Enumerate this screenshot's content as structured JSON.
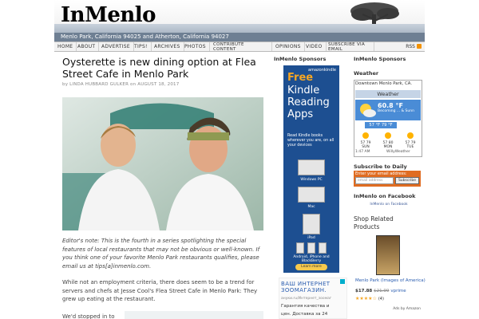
{
  "header": {
    "logo": "InMenlo",
    "tagline": "Menlo Park, California 94025 and Atherton, California 94027"
  },
  "nav": {
    "items": [
      "HOME",
      "ABOUT",
      "ADVERTISE",
      "TIPS!",
      "ARCHIVES",
      "PHOTOS"
    ],
    "contribute_1": "CONTRIBUTE",
    "contribute_2": "CONTENT",
    "items2": [
      "OPINIONS",
      "VIDEO"
    ],
    "subscribe": "SUBSCRIBE VIA EMAIL",
    "rss": "RSS"
  },
  "article": {
    "title": "Oysterette is new dining option at Flea Street Cafe in Menlo Park",
    "by": "by",
    "author": "LINDA HUBBARD GULKER",
    "on": "on",
    "date": "AUGUST 18, 2017",
    "note": "Editor's note: This is the fourth in a series spotlighting the special features of local restaurants that may not be obvious or well-known. If you think one of your favorite Menlo Park restaurants qualifies, please email us at tips[a]inmenlo.com.",
    "para1": "While not an employment criteria, there does seem to be a trend for servers and chefs at Jesse Cool's Flea Street Cafe in Menlo Park: They grew up eating at the restaurant.",
    "para2": "We'd stopped in to"
  },
  "sponsors_mid": {
    "title": "InMenlo Sponsors",
    "kindle": {
      "brand": "amazonkindle",
      "free": "Free",
      "line1": "Kindle",
      "line2": "Reading",
      "line3": "Apps",
      "sub": "Read Kindle books wherever you are, on all your devices",
      "devices": [
        "Windows PC",
        "Mac",
        "iPad",
        "Android, iPhone and BlackBerry"
      ],
      "cta": "Learn more"
    },
    "ru_ad": {
      "head": "ВАШ ИНТЕРНЕТ",
      "head2": "ЗООМАГАЗИН.",
      "url": "ануки.ru/Интернет_зоомаг",
      "line1": "Гарантия качества и",
      "line2": "цен. Доставка за 24"
    }
  },
  "sponsors_right": {
    "title": "InMenlo Sponsors",
    "weather": {
      "label": "Weather",
      "location": "Downtown Menlo Park, CA.",
      "title": "Weather",
      "temp": "60.8 °F",
      "condition": "Becoming ... & Sunn",
      "hilo": "57 °F  79 °F",
      "days": [
        {
          "name": "SUN",
          "temp": "57 79"
        },
        {
          "name": "MON",
          "temp": "57 80"
        },
        {
          "name": "TUE",
          "temp": "57 79"
        }
      ],
      "time": "1:47 AM",
      "brand": "WillyWeather"
    },
    "subscribe": {
      "title": "Subscribe to Daily Email",
      "label": "Enter your email address:",
      "placeholder": "email address",
      "button": "Subscribe"
    },
    "facebook": {
      "title": "InMenlo on Facebook",
      "link": "InMenlo on Facebook"
    },
    "shop": {
      "title_1": "Shop Related",
      "title_2": "Products",
      "book_title": "Menlo Park (Images of America)",
      "price": "$17.88",
      "price_old": "$21.99",
      "prime": "vprime",
      "stars": "★★★★☆",
      "reviews": "(4)",
      "ads_by": "Ads by Amazon"
    }
  },
  "colors": {
    "accent_orange": "#e06c21",
    "kindle_blue": "#1d4f91",
    "tagline_bar": "#6e7f93"
  }
}
